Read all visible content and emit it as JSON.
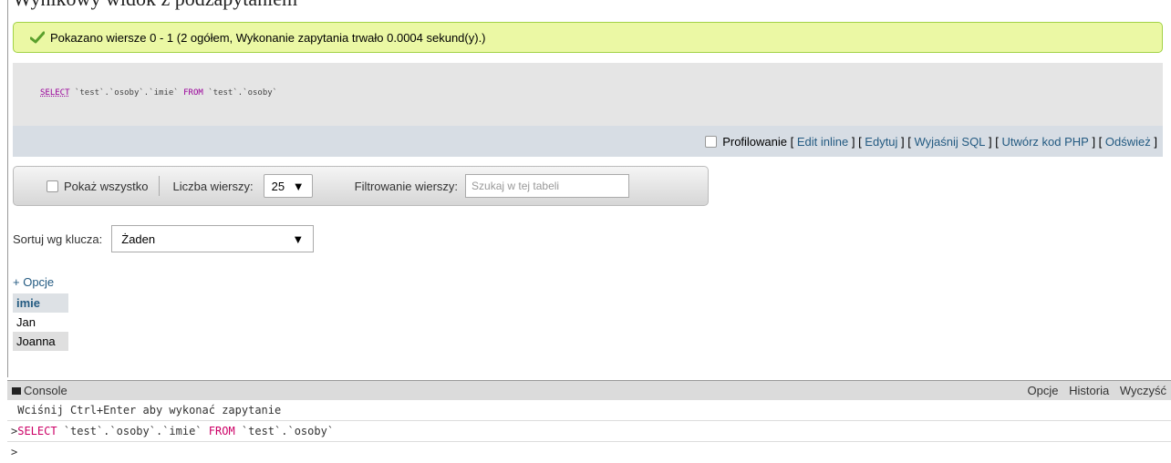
{
  "top_cut_text": "Wynikowy widok z podzapytaniem",
  "success_message": "Pokazano wiersze 0 - 1 (2 ogółem, Wykonanie zapytania trwało 0.0004 sekund(y).)",
  "sql": {
    "kw_select": "SELECT",
    "part1": " `test`.`osoby`.`imie` ",
    "kw_from": "FROM",
    "part2": " `test`.`osoby`"
  },
  "tools": {
    "profiling_label": "Profilowanie",
    "links": [
      "Edit inline",
      "Edytuj",
      "Wyjaśnij SQL",
      "Utwórz kod PHP",
      "Odśwież"
    ]
  },
  "nav": {
    "show_all_label": "Pokaż wszystko",
    "rows_label": "Liczba wierszy:",
    "rows_value": "25",
    "filter_label": "Filtrowanie wierszy:",
    "filter_placeholder": "Szukaj w tej tabeli"
  },
  "sort": {
    "label": "Sortuj wg klucza:",
    "value": "Żaden"
  },
  "options_label": "+ Opcje",
  "table": {
    "header": "imie",
    "rows": [
      "Jan",
      "Joanna"
    ]
  },
  "console": {
    "title": "Console",
    "actions": [
      "Opcje",
      "Historia",
      "Wyczyść"
    ],
    "hint": "Wciśnij Ctrl+Enter aby wykonać zapytanie",
    "prompt": ">",
    "query": {
      "kw_select": "SELECT",
      "part1": " `test`.`osoby`.`imie` ",
      "kw_from": "FROM",
      "part2": " `test`.`osoby`"
    }
  },
  "colors": {
    "success_bg": "#ebf8a4",
    "link": "#235a81",
    "sql_keyword": "#990099",
    "console_keyword": "#cc0066"
  },
  "icons": {
    "success": "check-icon",
    "console": "console-icon",
    "select_arrow": "dropdown-arrow-icon"
  }
}
